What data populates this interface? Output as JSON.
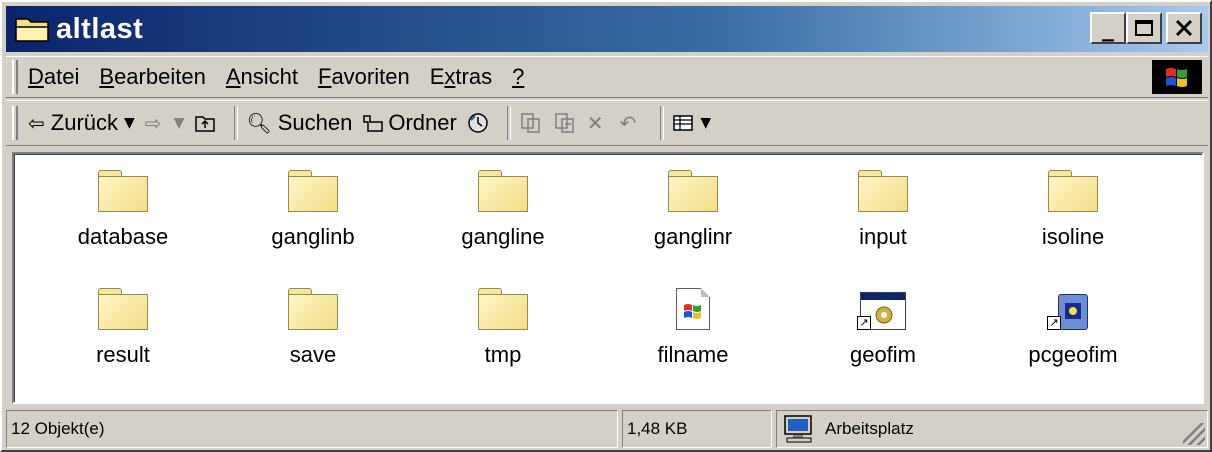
{
  "window": {
    "title": "altlast",
    "controls": {
      "minimize": "_",
      "maximize": "□",
      "close": "×"
    }
  },
  "menu": {
    "items": [
      {
        "accel": "D",
        "rest": "atei"
      },
      {
        "accel": "B",
        "rest": "earbeiten"
      },
      {
        "accel": "A",
        "rest": "nsicht"
      },
      {
        "accel": "F",
        "rest": "avoriten"
      },
      {
        "pre": "E",
        "accel": "x",
        "rest": "tras"
      },
      {
        "accel": "?",
        "rest": ""
      }
    ]
  },
  "toolbar": {
    "back_label": "Zurück",
    "search_label": "Suchen",
    "folders_label": "Ordner"
  },
  "files": [
    {
      "name": "database",
      "type": "folder"
    },
    {
      "name": "ganglinb",
      "type": "folder"
    },
    {
      "name": "gangline",
      "type": "folder"
    },
    {
      "name": "ganglinr",
      "type": "folder"
    },
    {
      "name": "input",
      "type": "folder"
    },
    {
      "name": "isoline",
      "type": "folder"
    },
    {
      "name": "result",
      "type": "folder"
    },
    {
      "name": "save",
      "type": "folder"
    },
    {
      "name": "tmp",
      "type": "folder"
    },
    {
      "name": "filname",
      "type": "document"
    },
    {
      "name": "geofim",
      "type": "shortcut-app"
    },
    {
      "name": "pcgeofim",
      "type": "shortcut-app"
    }
  ],
  "status": {
    "count": "12 Objekt(e)",
    "size": "1,48 KB",
    "location": "Arbeitsplatz"
  },
  "colors": {
    "title_gradient_start": "#0a246a",
    "title_gradient_end": "#a6caf0",
    "face": "#d4d0c8",
    "folder": "#f3dd86"
  }
}
